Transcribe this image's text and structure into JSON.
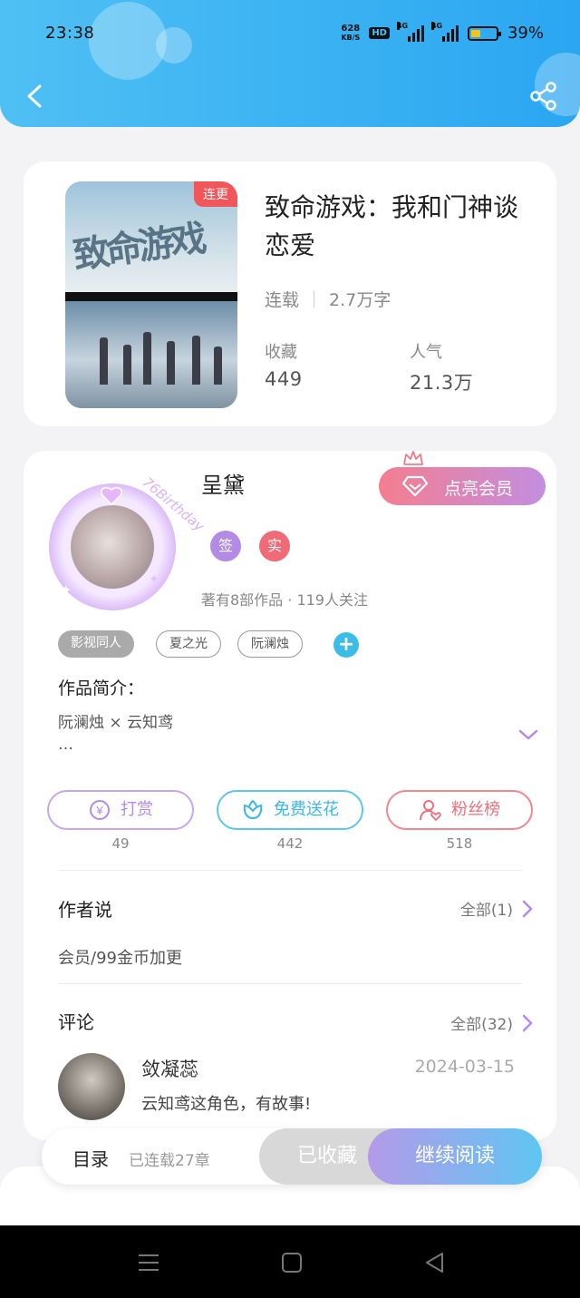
{
  "status_bar": {
    "time": "23:38",
    "net_speed_value": "628",
    "net_speed_unit": "KB/S",
    "hd_label": "HD",
    "signal_1": "4G",
    "signal_2": "4G",
    "battery": "39%",
    "battery_level": 0.39
  },
  "header": {
    "back_icon": "chevron-left-icon",
    "share_icon": "share-icon",
    "color_start": "#4fc0f3",
    "color_end": "#2aa6f2"
  },
  "book": {
    "status_badge": "连更",
    "title": "致命游戏：我和门神谈恋爱",
    "status": "连载",
    "word_count": "2.7万字",
    "favorites_label": "收藏",
    "favorites_value": "449",
    "popularity_label": "人气",
    "popularity_value": "21.3万",
    "cover_text": "致命游戏"
  },
  "author": {
    "name": "呈黛",
    "vip_button": "点亮会员",
    "badge_signed": "签",
    "badge_verified": "实",
    "works_info": "著有8部作品 · 119人关注",
    "tags": [
      "影视同人",
      "夏之光",
      "阮澜烛"
    ],
    "add_tag": "+",
    "avatar_deco_text": "76Birthday"
  },
  "intro": {
    "title": "作品简介：",
    "text_line1": "阮澜烛 × 云知鸢",
    "text_line2": "…"
  },
  "actions": {
    "tip_label": "打赏",
    "tip_icon": "yen-icon",
    "tip_count": "49",
    "flower_label": "免费送花",
    "flower_icon": "flower-icon",
    "flower_count": "442",
    "fans_label": "粉丝榜",
    "fans_icon": "user-heart-icon",
    "fans_count": "518"
  },
  "author_says": {
    "title": "作者说",
    "all_label": "全部(1)",
    "text": "会员/99金币加更"
  },
  "comments": {
    "title": "评论",
    "all_label": "全部(32)",
    "items": [
      {
        "user": "敛凝蕊",
        "date": "2024-03-15",
        "text": "云知鸢这角色，有故事!"
      }
    ]
  },
  "bottom_bar": {
    "toc_label": "目录",
    "toc_sub": "已连载27章",
    "collected_label": "已收藏",
    "continue_label": "继续阅读"
  },
  "nav_bar": {
    "menu_icon": "menu-icon",
    "home_icon": "home-square-icon",
    "back_icon": "back-triangle-icon"
  }
}
